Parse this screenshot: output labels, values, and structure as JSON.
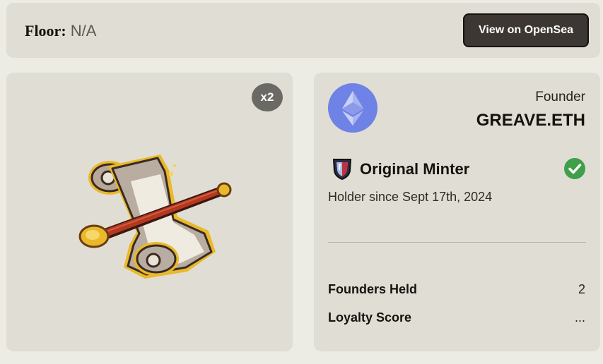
{
  "floor": {
    "label": "Floor:",
    "value": "N/A"
  },
  "opensea_button": {
    "label": "View on OpenSea"
  },
  "token": {
    "quantity_badge": "x2",
    "image": "scroll-icon"
  },
  "owner": {
    "avatar": "ethereum-icon",
    "type": "Founder",
    "name": "GREAVE.ETH"
  },
  "status": {
    "icon": "shield-icon",
    "title": "Original Minter",
    "verified_icon": "check-circle-icon",
    "holder_since": "Holder since Sept 17th, 2024"
  },
  "stats": [
    {
      "label": "Founders Held",
      "value": "2"
    },
    {
      "label": "Loyalty Score",
      "value": "..."
    }
  ],
  "colors": {
    "page_background": "#ecebe4",
    "panel": "#e0ded4",
    "button": "#3c3732",
    "badge": "#6b6963",
    "eth_avatar": "#6f82e6",
    "check": "#3fa049"
  }
}
